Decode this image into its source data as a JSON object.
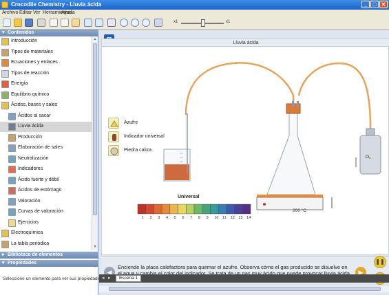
{
  "window": {
    "title": "Crocodile Chemistry - Lluvia ácida",
    "minimize": "_",
    "maximize": "□",
    "close": "✕"
  },
  "menu": [
    "Archivo",
    "Editar",
    "Ver",
    "Herramientas",
    "Ayuda"
  ],
  "toolbar": {
    "icons": [
      "new-icon",
      "open-icon",
      "save-icon",
      "print-icon",
      "cut-icon",
      "copy-icon",
      "paste-icon",
      "undo-icon",
      "redo-icon",
      "chart-icon",
      "zoom-in-icon",
      "zoom-out-icon",
      "zoom-fit-icon",
      "pause-icon"
    ],
    "speed_min_label": "x1",
    "speed_max_label": "x1"
  },
  "sidebar": {
    "contents_header": "Contenidos",
    "tree": [
      {
        "label": "Introducción",
        "level": 0,
        "color": "#e2c24a"
      },
      {
        "label": "Tipos de materiales",
        "level": 0,
        "color": "#c9a16b"
      },
      {
        "label": "Ecuaciones y enlaces",
        "level": 0,
        "color": "#e08a3a"
      },
      {
        "label": "Tipos de reacción",
        "level": 0,
        "color": "#d0d7e2"
      },
      {
        "label": "Energía",
        "level": 0,
        "color": "#e85c3a"
      },
      {
        "label": "Equilibrio químico",
        "level": 0,
        "color": "#8fb26a"
      },
      {
        "label": "Ácidos, bases y sales",
        "level": 0,
        "color": "#e2c24a"
      },
      {
        "label": "Ácidos al sacar",
        "level": 1,
        "color": "#7fa0c8"
      },
      {
        "label": "Lluvia ácida",
        "level": 1,
        "color": "#6f7f8f",
        "selected": true
      },
      {
        "label": "Producción",
        "level": 1,
        "color": "#c9a16b"
      },
      {
        "label": "Elaboración de sales",
        "level": 1,
        "color": "#7fa0c8"
      },
      {
        "label": "Neutralización",
        "level": 1,
        "color": "#6fa6c8"
      },
      {
        "label": "Indicadores",
        "level": 1,
        "color": "#e86a4a"
      },
      {
        "label": "Ácido fuerte y débil",
        "level": 1,
        "color": "#6fa6c8"
      },
      {
        "label": "Ácidos de estómago",
        "level": 1,
        "color": "#d06a5a"
      },
      {
        "label": "Valoración",
        "level": 1,
        "color": "#7fa0c8"
      },
      {
        "label": "Curvas de valoración",
        "level": 1,
        "color": "#6fa6c8"
      },
      {
        "label": "Ejercicios",
        "level": 1,
        "color": "#f0d98a"
      },
      {
        "label": "Electroquímica",
        "level": 0,
        "color": "#e2c24a"
      },
      {
        "label": "La tabla periódica",
        "level": 0,
        "color": "#c9a16b"
      }
    ],
    "library_header": "Biblioteca de elementos",
    "properties_header": "Propiedades",
    "properties_text": "Seleccione un elemento para ver sus propiedades"
  },
  "scene": {
    "title": "Lluvia ácida",
    "logo": "m",
    "legend": [
      {
        "label": "Azufre",
        "icon": "sulfur-icon"
      },
      {
        "label": "Indicador universal",
        "icon": "indicator-icon"
      },
      {
        "label": "Piedra caliza",
        "icon": "limestone-icon"
      }
    ],
    "scale_title": "Universal",
    "scale_ticks": [
      "1",
      "2",
      "3",
      "4",
      "5",
      "6",
      "7",
      "8",
      "9",
      "10",
      "11",
      "12",
      "13",
      "14"
    ],
    "scale_colors": [
      "#b8332c",
      "#cc4a2e",
      "#dd6a32",
      "#e68c3a",
      "#ecb548",
      "#ecd55a",
      "#b8cf62",
      "#6fb86a",
      "#4aa27a",
      "#3a9a9a",
      "#3a7cb8",
      "#3a5cb0",
      "#4a3e9e",
      "#5a2e86"
    ],
    "hotplate_readout": "200 °C",
    "gas_label": "O₂",
    "beaker_ph": 2
  },
  "info": {
    "text": "Enciende la placa calefactora para quemar el azufre. Observa cómo el gas producido se disuelve en el agua y cambia el color del indicador. Se trata de un gas muy ácido que puede provocar lluvia ácida."
  },
  "tabs": [
    "Escena 1"
  ]
}
